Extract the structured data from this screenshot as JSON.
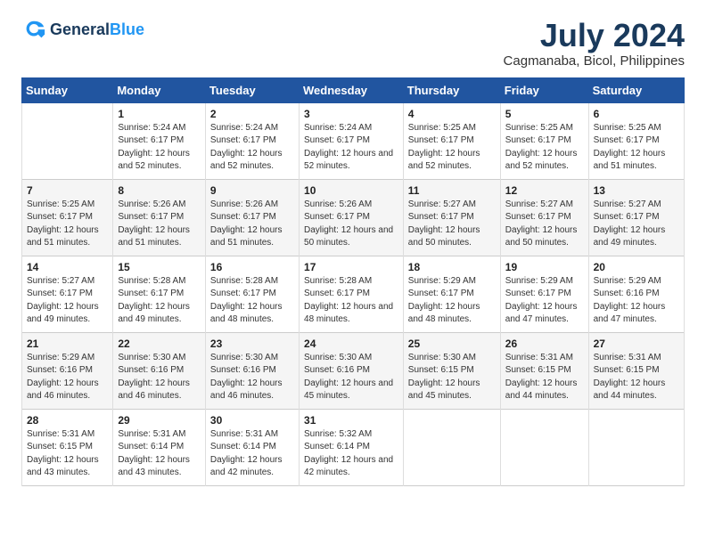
{
  "logo": {
    "line1": "General",
    "line2": "Blue"
  },
  "title": "July 2024",
  "location": "Cagmanaba, Bicol, Philippines",
  "headers": [
    "Sunday",
    "Monday",
    "Tuesday",
    "Wednesday",
    "Thursday",
    "Friday",
    "Saturday"
  ],
  "weeks": [
    [
      {
        "day": "",
        "sunrise": "",
        "sunset": "",
        "daylight": ""
      },
      {
        "day": "1",
        "sunrise": "Sunrise: 5:24 AM",
        "sunset": "Sunset: 6:17 PM",
        "daylight": "Daylight: 12 hours and 52 minutes."
      },
      {
        "day": "2",
        "sunrise": "Sunrise: 5:24 AM",
        "sunset": "Sunset: 6:17 PM",
        "daylight": "Daylight: 12 hours and 52 minutes."
      },
      {
        "day": "3",
        "sunrise": "Sunrise: 5:24 AM",
        "sunset": "Sunset: 6:17 PM",
        "daylight": "Daylight: 12 hours and 52 minutes."
      },
      {
        "day": "4",
        "sunrise": "Sunrise: 5:25 AM",
        "sunset": "Sunset: 6:17 PM",
        "daylight": "Daylight: 12 hours and 52 minutes."
      },
      {
        "day": "5",
        "sunrise": "Sunrise: 5:25 AM",
        "sunset": "Sunset: 6:17 PM",
        "daylight": "Daylight: 12 hours and 52 minutes."
      },
      {
        "day": "6",
        "sunrise": "Sunrise: 5:25 AM",
        "sunset": "Sunset: 6:17 PM",
        "daylight": "Daylight: 12 hours and 51 minutes."
      }
    ],
    [
      {
        "day": "7",
        "sunrise": "Sunrise: 5:25 AM",
        "sunset": "Sunset: 6:17 PM",
        "daylight": "Daylight: 12 hours and 51 minutes."
      },
      {
        "day": "8",
        "sunrise": "Sunrise: 5:26 AM",
        "sunset": "Sunset: 6:17 PM",
        "daylight": "Daylight: 12 hours and 51 minutes."
      },
      {
        "day": "9",
        "sunrise": "Sunrise: 5:26 AM",
        "sunset": "Sunset: 6:17 PM",
        "daylight": "Daylight: 12 hours and 51 minutes."
      },
      {
        "day": "10",
        "sunrise": "Sunrise: 5:26 AM",
        "sunset": "Sunset: 6:17 PM",
        "daylight": "Daylight: 12 hours and 50 minutes."
      },
      {
        "day": "11",
        "sunrise": "Sunrise: 5:27 AM",
        "sunset": "Sunset: 6:17 PM",
        "daylight": "Daylight: 12 hours and 50 minutes."
      },
      {
        "day": "12",
        "sunrise": "Sunrise: 5:27 AM",
        "sunset": "Sunset: 6:17 PM",
        "daylight": "Daylight: 12 hours and 50 minutes."
      },
      {
        "day": "13",
        "sunrise": "Sunrise: 5:27 AM",
        "sunset": "Sunset: 6:17 PM",
        "daylight": "Daylight: 12 hours and 49 minutes."
      }
    ],
    [
      {
        "day": "14",
        "sunrise": "Sunrise: 5:27 AM",
        "sunset": "Sunset: 6:17 PM",
        "daylight": "Daylight: 12 hours and 49 minutes."
      },
      {
        "day": "15",
        "sunrise": "Sunrise: 5:28 AM",
        "sunset": "Sunset: 6:17 PM",
        "daylight": "Daylight: 12 hours and 49 minutes."
      },
      {
        "day": "16",
        "sunrise": "Sunrise: 5:28 AM",
        "sunset": "Sunset: 6:17 PM",
        "daylight": "Daylight: 12 hours and 48 minutes."
      },
      {
        "day": "17",
        "sunrise": "Sunrise: 5:28 AM",
        "sunset": "Sunset: 6:17 PM",
        "daylight": "Daylight: 12 hours and 48 minutes."
      },
      {
        "day": "18",
        "sunrise": "Sunrise: 5:29 AM",
        "sunset": "Sunset: 6:17 PM",
        "daylight": "Daylight: 12 hours and 48 minutes."
      },
      {
        "day": "19",
        "sunrise": "Sunrise: 5:29 AM",
        "sunset": "Sunset: 6:17 PM",
        "daylight": "Daylight: 12 hours and 47 minutes."
      },
      {
        "day": "20",
        "sunrise": "Sunrise: 5:29 AM",
        "sunset": "Sunset: 6:16 PM",
        "daylight": "Daylight: 12 hours and 47 minutes."
      }
    ],
    [
      {
        "day": "21",
        "sunrise": "Sunrise: 5:29 AM",
        "sunset": "Sunset: 6:16 PM",
        "daylight": "Daylight: 12 hours and 46 minutes."
      },
      {
        "day": "22",
        "sunrise": "Sunrise: 5:30 AM",
        "sunset": "Sunset: 6:16 PM",
        "daylight": "Daylight: 12 hours and 46 minutes."
      },
      {
        "day": "23",
        "sunrise": "Sunrise: 5:30 AM",
        "sunset": "Sunset: 6:16 PM",
        "daylight": "Daylight: 12 hours and 46 minutes."
      },
      {
        "day": "24",
        "sunrise": "Sunrise: 5:30 AM",
        "sunset": "Sunset: 6:16 PM",
        "daylight": "Daylight: 12 hours and 45 minutes."
      },
      {
        "day": "25",
        "sunrise": "Sunrise: 5:30 AM",
        "sunset": "Sunset: 6:15 PM",
        "daylight": "Daylight: 12 hours and 45 minutes."
      },
      {
        "day": "26",
        "sunrise": "Sunrise: 5:31 AM",
        "sunset": "Sunset: 6:15 PM",
        "daylight": "Daylight: 12 hours and 44 minutes."
      },
      {
        "day": "27",
        "sunrise": "Sunrise: 5:31 AM",
        "sunset": "Sunset: 6:15 PM",
        "daylight": "Daylight: 12 hours and 44 minutes."
      }
    ],
    [
      {
        "day": "28",
        "sunrise": "Sunrise: 5:31 AM",
        "sunset": "Sunset: 6:15 PM",
        "daylight": "Daylight: 12 hours and 43 minutes."
      },
      {
        "day": "29",
        "sunrise": "Sunrise: 5:31 AM",
        "sunset": "Sunset: 6:14 PM",
        "daylight": "Daylight: 12 hours and 43 minutes."
      },
      {
        "day": "30",
        "sunrise": "Sunrise: 5:31 AM",
        "sunset": "Sunset: 6:14 PM",
        "daylight": "Daylight: 12 hours and 42 minutes."
      },
      {
        "day": "31",
        "sunrise": "Sunrise: 5:32 AM",
        "sunset": "Sunset: 6:14 PM",
        "daylight": "Daylight: 12 hours and 42 minutes."
      },
      {
        "day": "",
        "sunrise": "",
        "sunset": "",
        "daylight": ""
      },
      {
        "day": "",
        "sunrise": "",
        "sunset": "",
        "daylight": ""
      },
      {
        "day": "",
        "sunrise": "",
        "sunset": "",
        "daylight": ""
      }
    ]
  ]
}
